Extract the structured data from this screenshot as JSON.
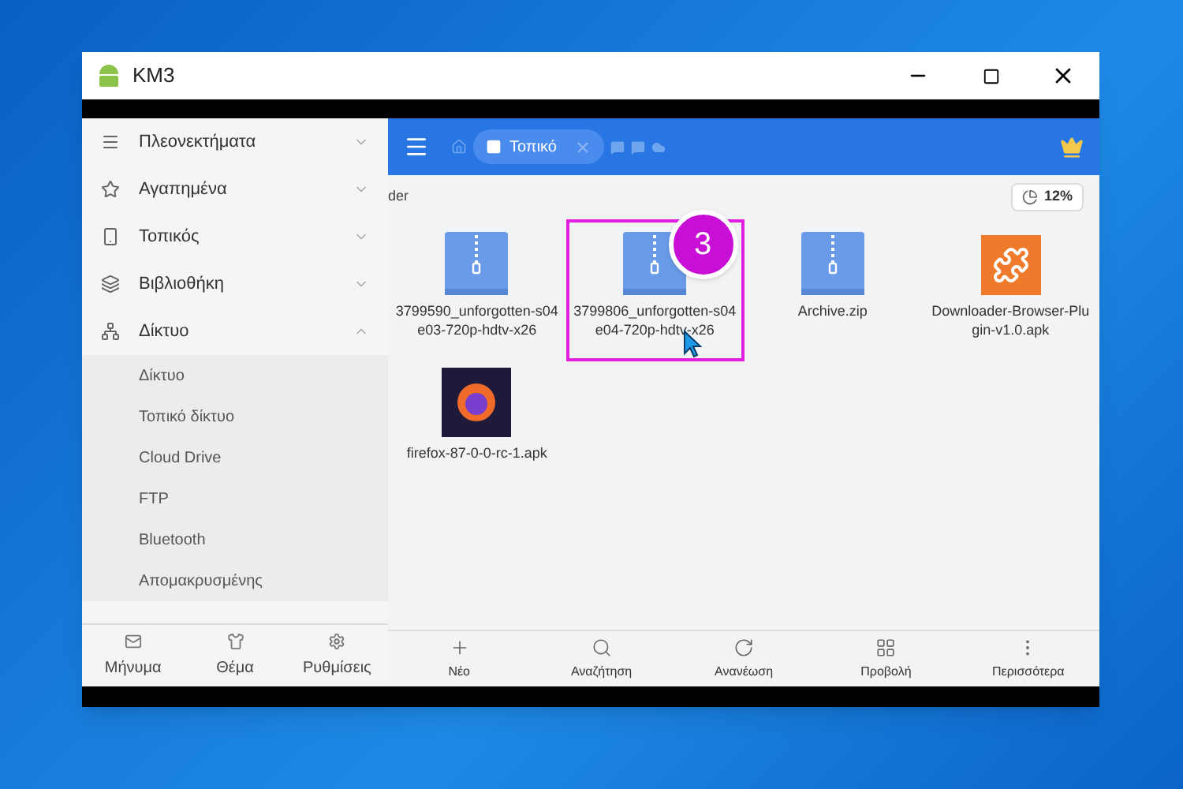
{
  "window": {
    "title": "KM3"
  },
  "sidebar": {
    "items": [
      {
        "label": "Πλεονεκτήματα",
        "expanded": false
      },
      {
        "label": "Αγαπημένα",
        "expanded": false
      },
      {
        "label": "Τοπικός",
        "expanded": false
      },
      {
        "label": "Βιβλιοθήκη",
        "expanded": false
      },
      {
        "label": "Δίκτυο",
        "expanded": true,
        "children": [
          {
            "label": "Δίκτυο"
          },
          {
            "label": "Τοπικό δίκτυο"
          },
          {
            "label": "Cloud Drive"
          },
          {
            "label": "FTP"
          },
          {
            "label": "Bluetooth"
          },
          {
            "label": "Απομακρυσμένης"
          }
        ]
      }
    ],
    "bottom_nav": [
      "Μήνυμα",
      "Θέμα",
      "Ρυθμίσεις"
    ]
  },
  "toolbar": {
    "tab": "Τοπικό"
  },
  "path_fragment": "der",
  "storage_badge": "12%",
  "files": [
    {
      "name": "3799590_unforgotten-s04e03-720p-hdtv-x26",
      "kind": "zip",
      "highlighted": false
    },
    {
      "name": "3799806_unforgotten-s04e04-720p-hdtv-x26",
      "kind": "zip",
      "highlighted": true
    },
    {
      "name": "Archive.zip",
      "kind": "zip",
      "highlighted": false
    },
    {
      "name": "Downloader-Browser-Plugin-v1.0.apk",
      "kind": "plugin",
      "highlighted": false
    },
    {
      "name": "firefox-87-0-0-rc-1.apk",
      "kind": "browser",
      "highlighted": false
    }
  ],
  "step_badge": "3",
  "actions": [
    "Νέο",
    "Αναζήτηση",
    "Ανανέωση",
    "Προβολή",
    "Περισσότερα"
  ]
}
